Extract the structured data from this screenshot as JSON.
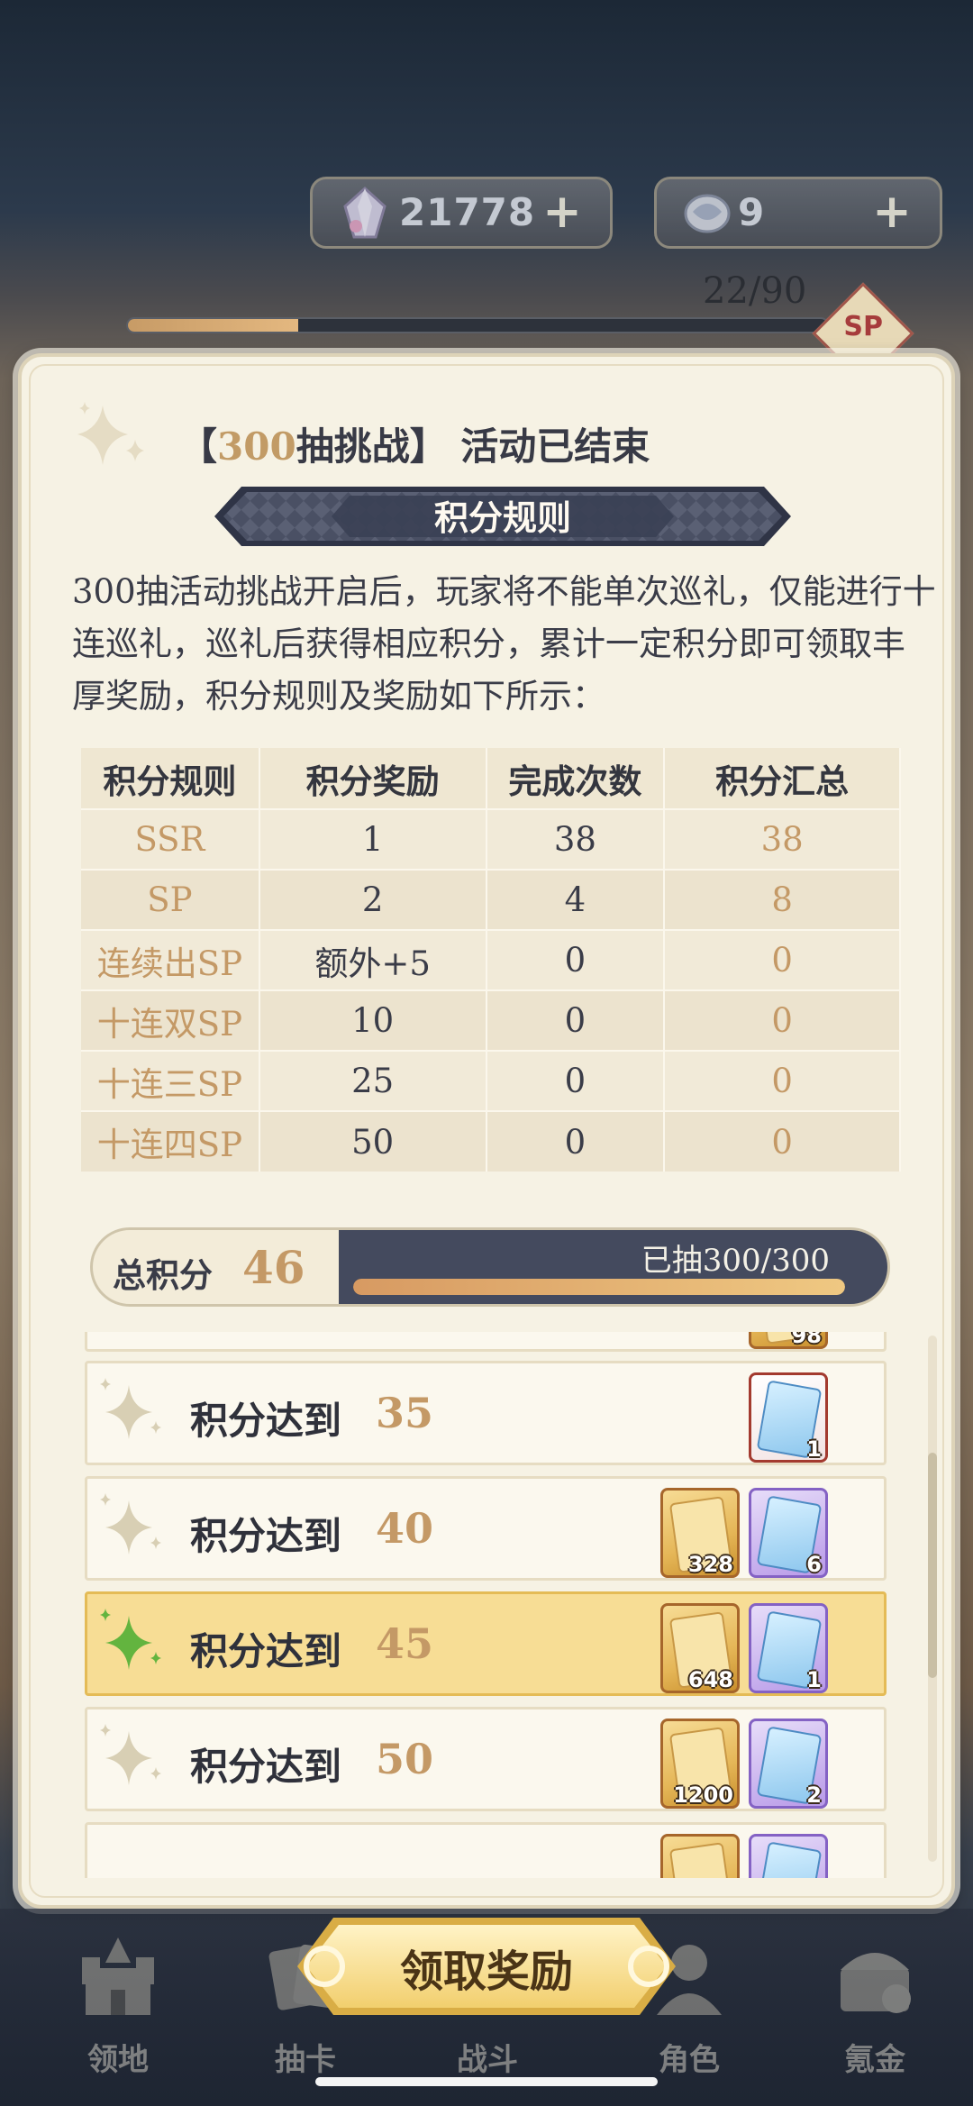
{
  "hud": {
    "currency1": {
      "value": "21778",
      "icon": "crystal-icon"
    },
    "currency2": {
      "value": "9",
      "icon": "scroll-ticket-icon"
    },
    "plus": "+",
    "draw_progress": "22/90",
    "draw_progress_fraction": 0.244,
    "sp_badge": "SP"
  },
  "panel": {
    "title_accent": "300",
    "title_main": "抽挑战】 活动已结束",
    "title_open": "【",
    "rule_banner": "积分规则",
    "rules_text": "300抽活动挑战开启后，玩家将不能单次巡礼，仅能进行十连巡礼，巡礼后获得相应积分，累计一定积分即可领取丰厚奖励，积分规则及奖励如下所示："
  },
  "table": {
    "headers": [
      "积分规则",
      "积分奖励",
      "完成次数",
      "积分汇总"
    ],
    "rows": [
      {
        "rule": "SSR",
        "reward": "1",
        "count": "38",
        "total": "38"
      },
      {
        "rule": "SP",
        "reward": "2",
        "count": "4",
        "total": "8"
      },
      {
        "rule": "连续出SP",
        "reward": "额外+5",
        "count": "0",
        "total": "0"
      },
      {
        "rule": "十连双SP",
        "reward": "10",
        "count": "0",
        "total": "0"
      },
      {
        "rule": "十连三SP",
        "reward": "25",
        "count": "0",
        "total": "0"
      },
      {
        "rule": "十连四SP",
        "reward": "50",
        "count": "0",
        "total": "0"
      }
    ]
  },
  "total": {
    "label": "总积分",
    "value": "46",
    "drawn": "已抽300/300",
    "drawn_fraction": 1.0
  },
  "rewards": {
    "label": "积分达到",
    "rows": [
      {
        "threshold": "35",
        "highlight": false,
        "items": [
          {
            "type": "ticket-red",
            "count": "1"
          }
        ]
      },
      {
        "threshold": "40",
        "highlight": false,
        "items": [
          {
            "type": "gold",
            "count": "328"
          },
          {
            "type": "ticket",
            "count": "6"
          }
        ]
      },
      {
        "threshold": "45",
        "highlight": true,
        "items": [
          {
            "type": "gold",
            "count": "648"
          },
          {
            "type": "ticket",
            "count": "1"
          }
        ]
      },
      {
        "threshold": "50",
        "highlight": false,
        "items": [
          {
            "type": "gold",
            "count": "1200"
          },
          {
            "type": "ticket",
            "count": "2"
          }
        ]
      }
    ],
    "partial_top_count": "98"
  },
  "nav": {
    "items": [
      {
        "label": "领地",
        "icon": "castle-icon"
      },
      {
        "label": "抽卡",
        "icon": "cards-icon"
      },
      {
        "label": "战斗",
        "icon": "battle-icon"
      },
      {
        "label": "角色",
        "icon": "character-icon"
      },
      {
        "label": "氪金",
        "icon": "treasure-chest-icon"
      }
    ],
    "claim_button": "领取奖励"
  },
  "colors": {
    "accent_gold": "#c49966",
    "highlight_row": "#f7dd95",
    "panel_bg": "#f6f2e4",
    "bar_dark": "#444a5e"
  }
}
